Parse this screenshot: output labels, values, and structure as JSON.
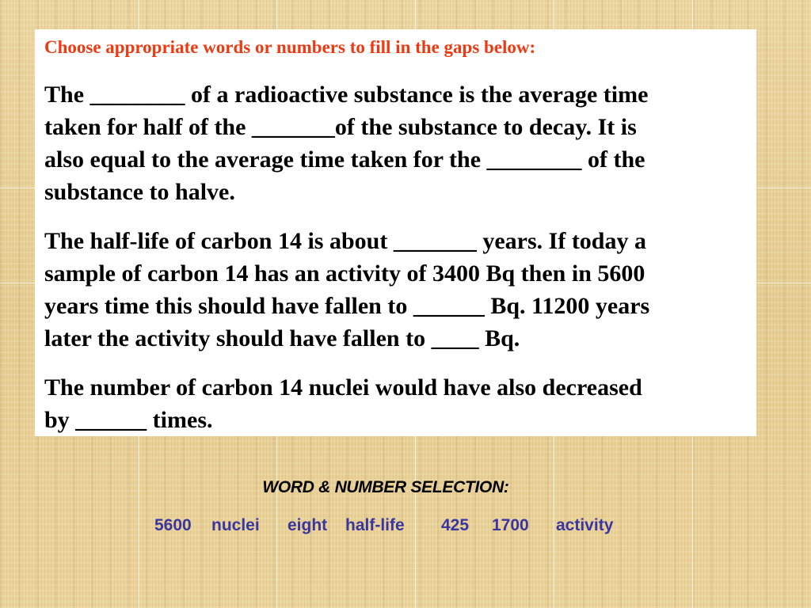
{
  "instruction": "Choose appropriate words or numbers to fill in the gaps below:",
  "paragraphs": [
    {
      "lines": [
        "The ________ of a radioactive substance is the average time",
        "taken for half of the _______of the substance to decay. It is",
        "also equal to the average time taken for the ________ of the",
        "substance to halve."
      ]
    },
    {
      "lines": [
        "The half-life of carbon 14 is about _______ years. If today a",
        "sample of carbon 14 has an activity of 3400 Bq then in 5600",
        "years time this should have fallen to ______ Bq. 11200 years",
        "later the activity should have fallen to ____ Bq."
      ]
    },
    {
      "lines": [
        "The number of carbon 14 nuclei would have also decreased",
        "by ______ times."
      ]
    }
  ],
  "selection": {
    "title": "WORD & NUMBER SELECTION:",
    "options": [
      "5600",
      "nuclei",
      "eight",
      "half-life",
      "425",
      "1700",
      "activity"
    ]
  },
  "colors": {
    "instruction": "#ee3a12",
    "options": "#3a36a0",
    "body_text": "#000000",
    "card": "#ffffff",
    "background": "#e9d19a"
  }
}
